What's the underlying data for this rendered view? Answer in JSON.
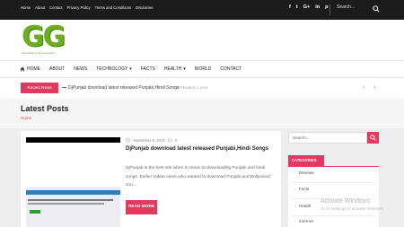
{
  "topbar": {
    "links": [
      "Home",
      "About",
      "Contact",
      "Privacy Policy",
      "Terms and Conditions",
      "Disclaimer"
    ],
    "social_icons": [
      "facebook-icon",
      "twitter-icon",
      "google-plus-icon",
      "linkedin-icon",
      "pinterest-icon"
    ],
    "social_glyphs": [
      "f",
      "t",
      "G+",
      "in",
      "p"
    ],
    "search_placeholder": "Search..."
  },
  "logo": {
    "letters": "GG",
    "tagline": "Geniusinfo is set to success"
  },
  "nav": {
    "items": [
      {
        "label": "HOME",
        "has_icon": true
      },
      {
        "label": "ABOUT"
      },
      {
        "label": "NEWS"
      },
      {
        "label": "TECHNOLOGY",
        "dropdown": true
      },
      {
        "label": "FACTS"
      },
      {
        "label": "HEALTH",
        "dropdown": true
      },
      {
        "label": "WORLD"
      },
      {
        "label": "CONTACT"
      }
    ]
  },
  "ticker": {
    "badge": "Recent News",
    "title": "DjPunjab download latest released Punjabi,Hindi Songs",
    "date": "SEPTEMBER 5, 2019"
  },
  "page": {
    "title": "Latest Posts",
    "breadcrumb": "Home"
  },
  "post": {
    "date": "September 5, 2019",
    "comments": "0",
    "title": "DjPunjab download latest released Punjabi,Hindi Songs",
    "excerpt": "DjPunjab is the best site when it comes to downloading Punjabi and hindi songs. Earlier Indian users who wanted to download Punjabi and Bollywood son…",
    "read_more": "READ MORE"
  },
  "sidebar": {
    "search_placeholder": "Search...",
    "categories_title": "CATEGORIES",
    "categories": [
      "Disease",
      "Facts",
      "Health",
      "Internet"
    ]
  },
  "watermark": {
    "line1": "Activate Windows",
    "line2": "Go to Settings to activate Windows."
  },
  "colors": {
    "accent": "#e23a5e",
    "logo_green": "#6dae1e",
    "topbar": "#1b1b1b"
  }
}
